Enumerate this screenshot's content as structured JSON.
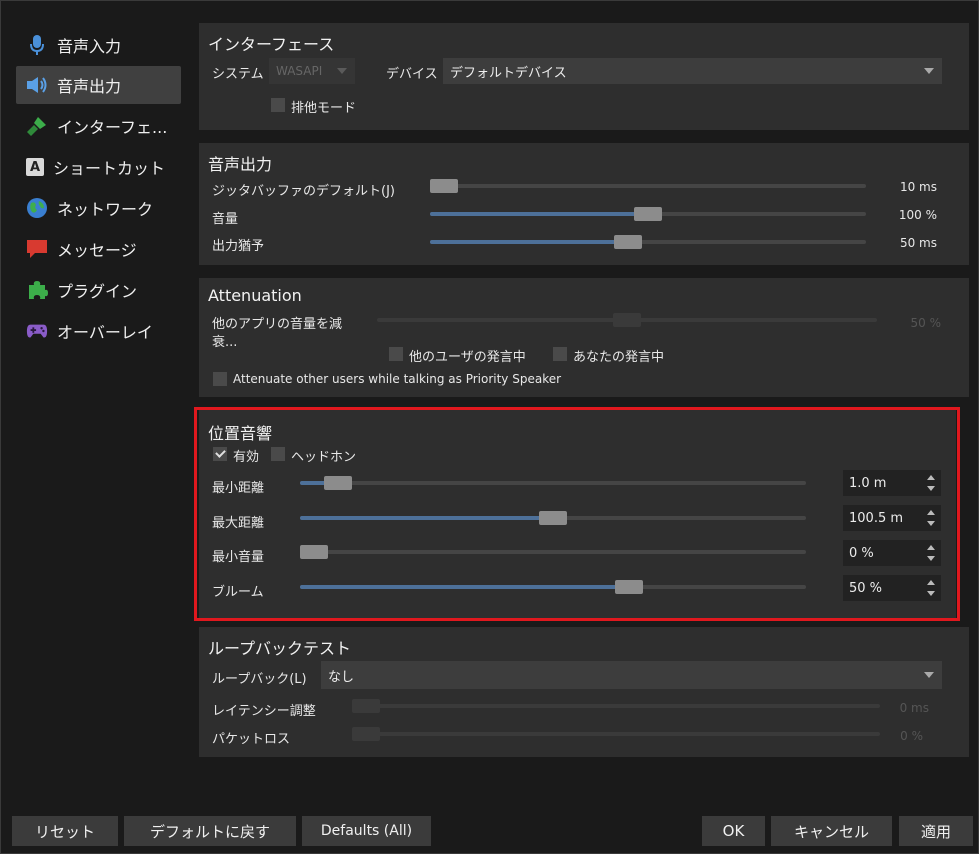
{
  "sidebar": {
    "items": [
      {
        "label": "音声入力",
        "icon": "microphone-icon"
      },
      {
        "label": "音声出力",
        "icon": "speaker-icon"
      },
      {
        "label": "インターフェ...",
        "icon": "paintbrush-icon"
      },
      {
        "label": "ショートカット",
        "icon": "keyboard-key-icon"
      },
      {
        "label": "ネットワーク",
        "icon": "globe-icon"
      },
      {
        "label": "メッセージ",
        "icon": "chat-bubble-icon"
      },
      {
        "label": "プラグイン",
        "icon": "puzzle-icon"
      },
      {
        "label": "オーバーレイ",
        "icon": "gamepad-icon"
      }
    ],
    "active_index": 1,
    "shortcut_key_glyph": "A"
  },
  "interface": {
    "title": "インターフェース",
    "system_label": "システム",
    "system_value": "WASAPI",
    "device_label": "デバイス",
    "device_value": "デフォルトデバイス",
    "exclusive_label": "排他モード",
    "exclusive_checked": false
  },
  "output": {
    "title": "音声出力",
    "jitter_label": "ジッタバッファのデフォルト(J)",
    "jitter_value": "10 ms",
    "jitter_fraction": 0.0,
    "volume_label": "音量",
    "volume_value": "100 %",
    "volume_fraction": 0.5,
    "delay_label": "出力猶予",
    "delay_value": "50 ms",
    "delay_fraction": 0.45
  },
  "attenuation": {
    "title": "Attenuation",
    "reduce_label_line1": "他のアプリの音量を減",
    "reduce_label_line2": "衰...",
    "reduce_value": "50 %",
    "reduce_fraction": 0.5,
    "others_label": "他のユーザの発言中",
    "self_label": "あなたの発言中",
    "priority_label": "Attenuate other users while talking as Priority Speaker"
  },
  "positional": {
    "title": "位置音響",
    "enabled_label": "有効",
    "enabled_checked": true,
    "headphone_label": "ヘッドホン",
    "headphone_checked": false,
    "rows": [
      {
        "label": "最小距離",
        "value": "1.0 m",
        "fraction": 0.05
      },
      {
        "label": "最大距離",
        "value": "100.5 m",
        "fraction": 0.5
      },
      {
        "label": "最小音量",
        "value": "0 %",
        "fraction": 0.0
      },
      {
        "label": "ブルーム",
        "value": "50 %",
        "fraction": 0.66
      }
    ]
  },
  "loopback": {
    "title": "ループバックテスト",
    "loopback_label": "ループバック(L)",
    "loopback_value": "なし",
    "latency_label": "レイテンシー調整",
    "latency_value": "0 ms",
    "packetloss_label": "パケットロス",
    "packetloss_value": "0 %"
  },
  "buttons": {
    "reset": "リセット",
    "restore_defaults": "デフォルトに戻す",
    "defaults_all": "Defaults (All)",
    "ok": "OK",
    "cancel": "キャンセル",
    "apply": "適用"
  },
  "colors": {
    "highlight": "#e0181e",
    "slider_fill": "#4d7099"
  }
}
